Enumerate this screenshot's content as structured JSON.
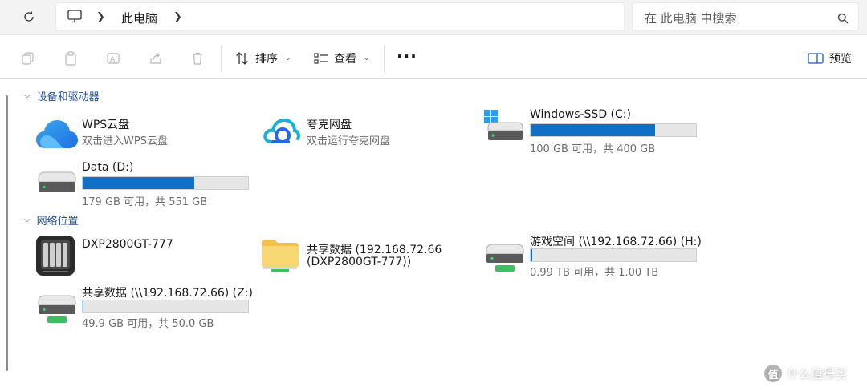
{
  "address": {
    "breadcrumb": "此电脑",
    "search_placeholder": "在 此电脑 中搜索"
  },
  "toolbar": {
    "sort_label": "排序",
    "view_label": "查看",
    "more_label": "···",
    "preview_label": "预览"
  },
  "groups": [
    {
      "title": "设备和驱动器"
    },
    {
      "title": "网络位置"
    }
  ],
  "devices": [
    {
      "name": "WPS云盘",
      "sub": "双击进入WPS云盘"
    },
    {
      "name": "夸克网盘",
      "sub": "双击运行夸克网盘"
    },
    {
      "name": "Windows-SSD (C:)",
      "sub": "100 GB 可用，共 400 GB",
      "used_fraction": 0.75
    },
    {
      "name": "Data (D:)",
      "sub": "179 GB 可用，共 551 GB",
      "used_fraction": 0.675
    }
  ],
  "network": [
    {
      "name": "DXP2800GT-777"
    },
    {
      "name": "共享数据 (192.168.72.66",
      "name2": "(DXP2800GT-777))"
    },
    {
      "name": "游戏空间 (\\\\192.168.72.66) (H:)",
      "sub": "0.99 TB 可用，共 1.00 TB",
      "used_fraction": 0.01
    },
    {
      "name": "共享数据 (\\\\192.168.72.66) (Z:)",
      "sub": "49.9 GB 可用，共 50.0 GB",
      "used_fraction": 0.002
    }
  ],
  "watermark": {
    "text": "什么值得买",
    "logo": "值"
  },
  "colors": {
    "accent": "#1070c8",
    "group_header": "#1f4f9c"
  }
}
